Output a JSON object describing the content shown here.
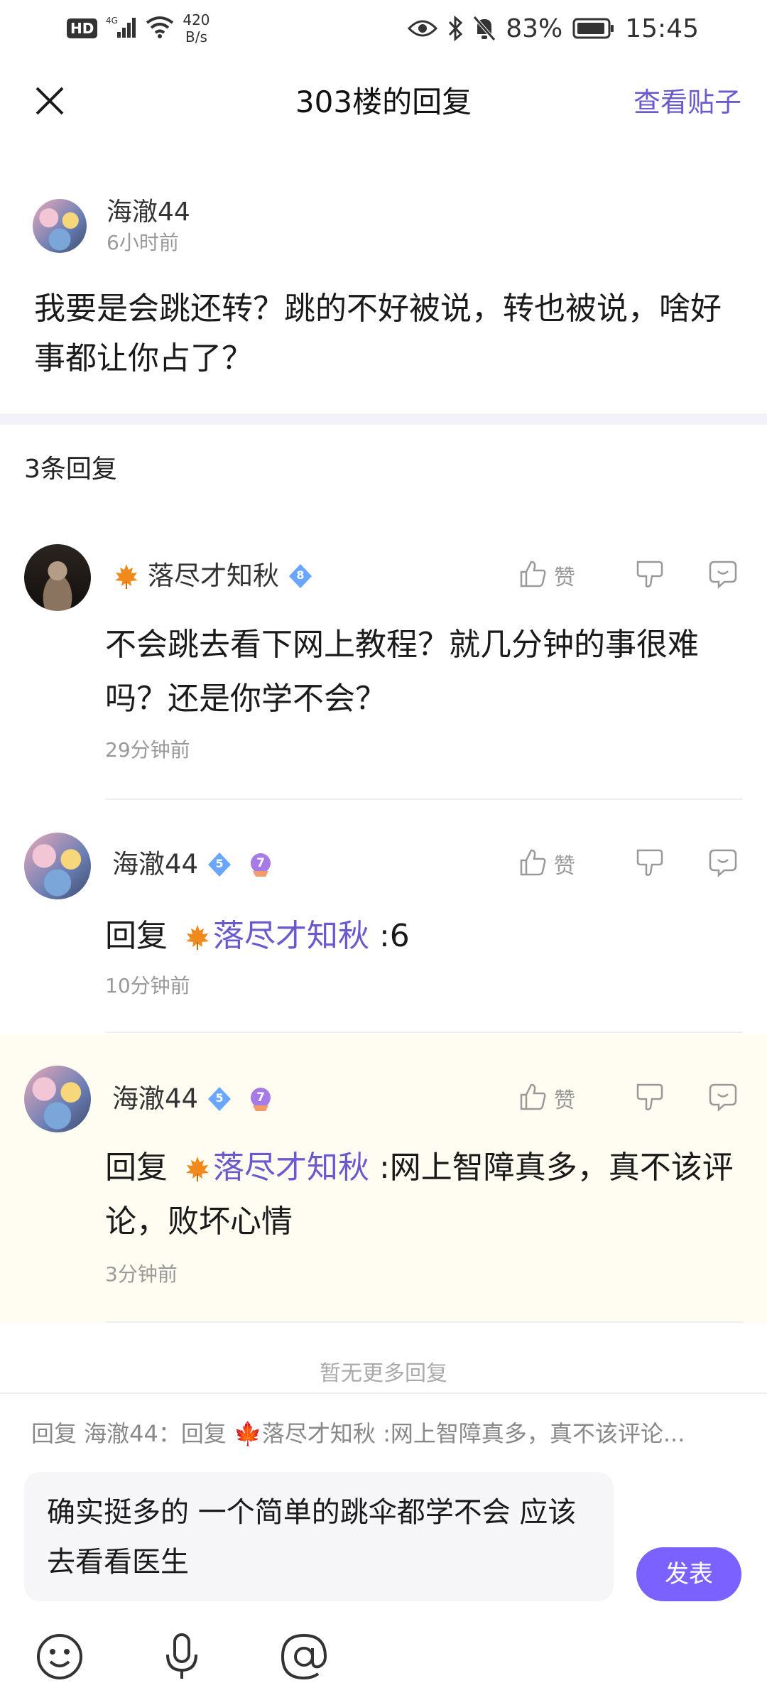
{
  "status_bar": {
    "hd": "HD",
    "network": "4G",
    "speed_value": "420",
    "speed_unit": "B/s",
    "battery": "83%",
    "time": "15:45"
  },
  "header": {
    "title": "303楼的回复",
    "view_post": "查看贴子"
  },
  "main_post": {
    "author": "海澈44",
    "time": "6小时前",
    "content": "我要是会跳还转？跳的不好被说，转也被说，啥好事都让你占了？"
  },
  "replies_header": "3条回复",
  "replies": [
    {
      "author": "落尽才知秋",
      "badge_level": "8",
      "content": "不会跳去看下网上教程？就几分钟的事很难吗？还是你学不会？",
      "time": "29分钟前",
      "like_label": "赞"
    },
    {
      "author": "海澈44",
      "badge_level": "5",
      "level": "7",
      "reply_prefix": "回复",
      "reply_target": "落尽才知秋",
      "content": " :6",
      "time": "10分钟前",
      "like_label": "赞"
    },
    {
      "author": "海澈44",
      "badge_level": "5",
      "level": "7",
      "reply_prefix": "回复",
      "reply_target": "落尽才知秋",
      "content": " :网上智障真多，真不该评论，败坏心情",
      "time": "3分钟前",
      "like_label": "赞"
    }
  ],
  "no_more": "暂无更多回复",
  "composer": {
    "quote": "回复 海澈44：回复 🍁落尽才知秋 :网上智障真多，真不该评论...",
    "input_value": "确实挺多的  一个简单的跳伞都学不会  应该去看看医生",
    "send_label": "发表"
  },
  "colors": {
    "accent": "#7b61ff",
    "link": "#6a5acd",
    "highlight_bg": "#fffdf2"
  },
  "icons": [
    "close-icon",
    "thumb-up-icon",
    "thumb-down-icon",
    "comment-icon",
    "maple-leaf-icon",
    "emoji-icon",
    "microphone-icon",
    "at-icon"
  ]
}
